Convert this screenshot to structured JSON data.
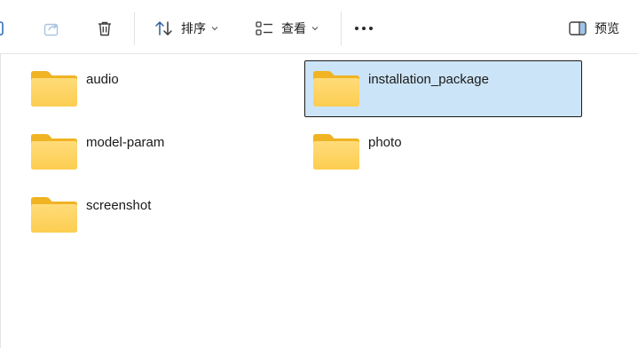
{
  "toolbar": {
    "sort_label": "排序",
    "view_label": "查看",
    "preview_label": "预览"
  },
  "icons": {
    "share": "share-icon",
    "delete": "trash-icon",
    "sort": "sort-icon",
    "view": "view-icon",
    "more": "more-icon",
    "preview": "preview-pane-icon",
    "folder": "folder-icon"
  },
  "colors": {
    "selection_bg": "#cce4f7",
    "folder_back": "#f2b928",
    "folder_front": "#ffd46b"
  },
  "folders": [
    {
      "name": "audio",
      "selected": false
    },
    {
      "name": "installation_package",
      "selected": true
    },
    {
      "name": "model-param",
      "selected": false
    },
    {
      "name": "photo",
      "selected": false
    },
    {
      "name": "screenshot",
      "selected": false
    }
  ]
}
